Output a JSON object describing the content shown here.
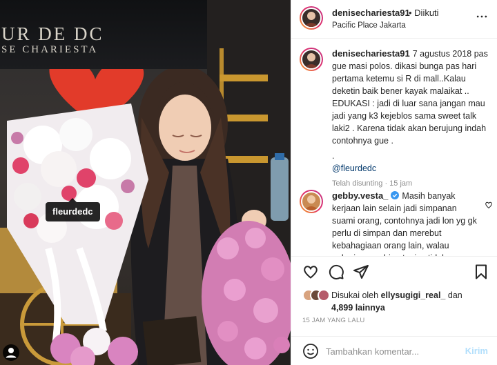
{
  "colors": {
    "accent": "#0095f6",
    "link": "#00376b",
    "muted": "#8e8e8e",
    "border": "#efefef",
    "post_disabled": "#b2dffc",
    "story_ring": "#e1306c"
  },
  "photo": {
    "sign_line1": "UR DE DC",
    "sign_line2": "SE CHARIESTA",
    "tag_label": "fleurdedc",
    "user_tag_icon": "user-icon"
  },
  "header": {
    "username": "denisechariesta91",
    "follow_status": "• Diikuti",
    "location": "Pacific Place Jakarta",
    "more_icon": "more-horizontal-icon"
  },
  "caption": {
    "username": "denisechariesta91",
    "text": "7 agustus 2018 pas gue masi polos. dikasi bunga pas hari pertama ketemu si R di mall..Kalau deketin baik bener kayak malaikat .. EDUKASI : jadi di luar sana jangan mau jadi yang k3 kejeblos sama sweet talk laki2 . Karena tidak akan berujung indah contohnya gue .",
    "dot": ".",
    "mention": "@fleurdedc",
    "edited": "Telah disunting · 15 jam"
  },
  "comment": {
    "username": "gebby.vesta_",
    "verified_icon": "verified-badge-icon",
    "text": "Masih banyak kerjaan lain selain jadi simpanan suami orang, contohnya jadi lon yg gk perlu di simpan dan merebut kebahagiaan orang lain, walau pekerjaan yg hina tapi setidaknya"
  },
  "actions": {
    "like_icon": "heart-icon",
    "comment_icon": "comment-icon",
    "share_icon": "paper-plane-icon",
    "save_icon": "bookmark-icon"
  },
  "likes": {
    "prefix": "Disukai oleh",
    "user": "ellysugigi_real_",
    "suffix": "dan",
    "count": "4,899 lainnya"
  },
  "timestamp": "15 JAM YANG LALU",
  "add_comment": {
    "emoji_icon": "emoji-icon",
    "placeholder": "Tambahkan komentar...",
    "post_label": "Kirim"
  }
}
